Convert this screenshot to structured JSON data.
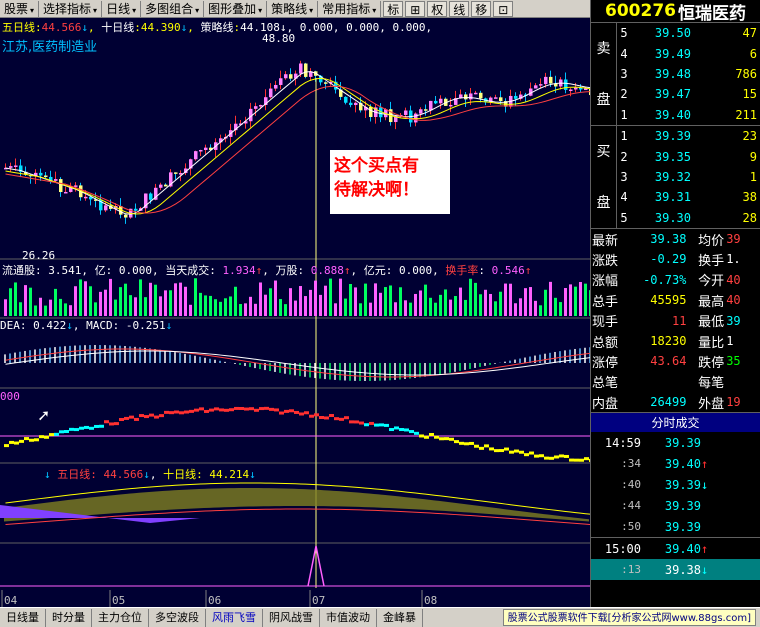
{
  "toolbar": {
    "items": [
      "股票",
      "选择指标",
      "日线",
      "多图组合",
      "图形叠加",
      "策略线",
      "常用指标"
    ],
    "square_buttons": [
      "标",
      "⊞",
      "权",
      "线",
      "移",
      "⊡"
    ]
  },
  "stock": {
    "code": "600276",
    "name": "恒瑞医药"
  },
  "main_chart": {
    "legend": {
      "name1": "五日线",
      "val1": "44.566",
      "arrow1": "↓",
      "name2": "十日线",
      "val2": "44.390",
      "arrow2": "↓",
      "name3": "策略线",
      "vals3": "44.108↓, 0.000, 0.000, 0.000,"
    },
    "region_label": "江苏,医药制造业",
    "high_label": "48.80",
    "low_label": "26.26"
  },
  "annotation": {
    "line1": "这个买点有",
    "line2": "待解决啊！"
  },
  "volume_legend": {
    "name1": "流通股",
    "val1": "3.541",
    "u1": "亿",
    "val2": "0.000",
    "name3": "当天成交",
    "val3": "1.934",
    "name4": "万股",
    "val4": "0.888",
    "name5": "亿元",
    "val5": "0.000",
    "name6": "换手率",
    "val6": "0.546"
  },
  "macd_legend": {
    "dea_name": "DEA",
    "dea_val": "0.422",
    "macd_name": "MACD",
    "macd_val": "-0.251"
  },
  "osc_label": "000",
  "lower_legend": {
    "name1": "五日线",
    "val1": "44.566",
    "name2": "十日线",
    "val2": "44.214"
  },
  "x_axis": [
    "04",
    "05",
    "06",
    "07",
    "08"
  ],
  "order_book": {
    "sell_label": [
      "卖",
      "盘"
    ],
    "buy_label": [
      "买",
      "盘"
    ],
    "sells": [
      {
        "lv": "5",
        "price": "39.50",
        "vol": "47"
      },
      {
        "lv": "4",
        "price": "39.49",
        "vol": "6"
      },
      {
        "lv": "3",
        "price": "39.48",
        "vol": "786"
      },
      {
        "lv": "2",
        "price": "39.47",
        "vol": "15"
      },
      {
        "lv": "1",
        "price": "39.40",
        "vol": "211"
      }
    ],
    "buys": [
      {
        "lv": "1",
        "price": "39.39",
        "vol": "23"
      },
      {
        "lv": "2",
        "price": "39.35",
        "vol": "9"
      },
      {
        "lv": "3",
        "price": "39.32",
        "vol": "1"
      },
      {
        "lv": "4",
        "price": "39.31",
        "vol": "38"
      },
      {
        "lv": "5",
        "price": "39.30",
        "vol": "28"
      }
    ]
  },
  "stats": [
    {
      "k": "最新",
      "v": "39.38",
      "vc": "#00ffff",
      "k2": "均价",
      "v2": "39"
    },
    {
      "k": "涨跌",
      "v": "-0.29",
      "vc": "#00ffff",
      "k2": "换手",
      "v2": "1.",
      "v2c": "#ffffff"
    },
    {
      "k": "涨幅",
      "v": "-0.73%",
      "vc": "#00ffff",
      "k2": "今开",
      "v2": "40"
    },
    {
      "k": "总手",
      "v": "45595",
      "vc": "#ffff00",
      "k2": "最高",
      "v2": "40"
    },
    {
      "k": "现手",
      "v": "11",
      "vc": "#ff4040",
      "k2": "最低",
      "v2": "39",
      "v2c": "#00ffff"
    },
    {
      "k": "总额",
      "v": "18230",
      "vc": "#ffff00",
      "k2": "量比",
      "v2": "1",
      "v2c": "#ffffff"
    },
    {
      "k": "涨停",
      "v": "43.64",
      "vc": "#ff4040",
      "k2": "跌停",
      "v2": "35",
      "v2c": "#00ff00"
    },
    {
      "k": "总笔",
      "v": "",
      "vc": "#ffff00",
      "k2": "每笔",
      "v2": ""
    },
    {
      "k": "内盘",
      "v": "26499",
      "vc": "#00ffff",
      "k2": "外盘",
      "v2": "19"
    }
  ],
  "ticks_title": "分时成交",
  "ticks": [
    {
      "t": "14:59",
      "p": "39.39",
      "a": "",
      "small": false,
      "hl": false
    },
    {
      "t": ":34",
      "p": "39.40",
      "a": "up",
      "small": true,
      "hl": false
    },
    {
      "t": ":40",
      "p": "39.39",
      "a": "dn",
      "small": true,
      "hl": false
    },
    {
      "t": ":44",
      "p": "39.39",
      "a": "",
      "small": true,
      "hl": false
    },
    {
      "t": ":50",
      "p": "39.39",
      "a": "",
      "small": true,
      "hl": false
    },
    {
      "t": "15:00",
      "p": "39.40",
      "a": "up",
      "small": false,
      "hl": false
    },
    {
      "t": ":13",
      "p": "39.38",
      "a": "dn",
      "small": true,
      "hl": true
    }
  ],
  "bottom_tabs": [
    "日线量",
    "时分量",
    "主力仓位",
    "多空波段",
    "风雨飞雪",
    "阴风战雪",
    "市值波动",
    "金峰暴"
  ],
  "active_tab": 4,
  "ad_text": "股票公式股票软件下载[分析家公式网www.88gs.com]"
}
